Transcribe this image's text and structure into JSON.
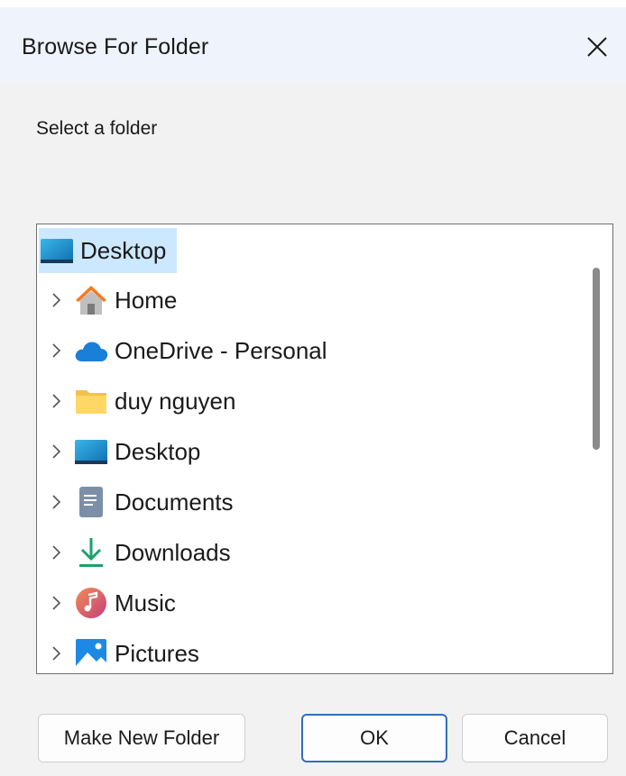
{
  "window": {
    "title": "Browse For Folder"
  },
  "prompt": "Select a folder",
  "tree": {
    "root": {
      "label": "Desktop",
      "icon": "desktop-icon",
      "selected": true
    },
    "items": [
      {
        "label": "Home",
        "icon": "home-icon"
      },
      {
        "label": "OneDrive - Personal",
        "icon": "onedrive-cloud-icon"
      },
      {
        "label": "duy nguyen",
        "icon": "user-folder-icon"
      },
      {
        "label": "Desktop",
        "icon": "desktop-icon"
      },
      {
        "label": "Documents",
        "icon": "documents-icon"
      },
      {
        "label": "Downloads",
        "icon": "downloads-icon"
      },
      {
        "label": "Music",
        "icon": "music-icon"
      },
      {
        "label": "Pictures",
        "icon": "pictures-icon"
      }
    ]
  },
  "buttons": {
    "make_new_folder": "Make New Folder",
    "ok": "OK",
    "cancel": "Cancel"
  },
  "colors": {
    "title_bar": "#eff3fb",
    "selection": "#cce8ff",
    "primary_border": "#2f6fbf"
  }
}
